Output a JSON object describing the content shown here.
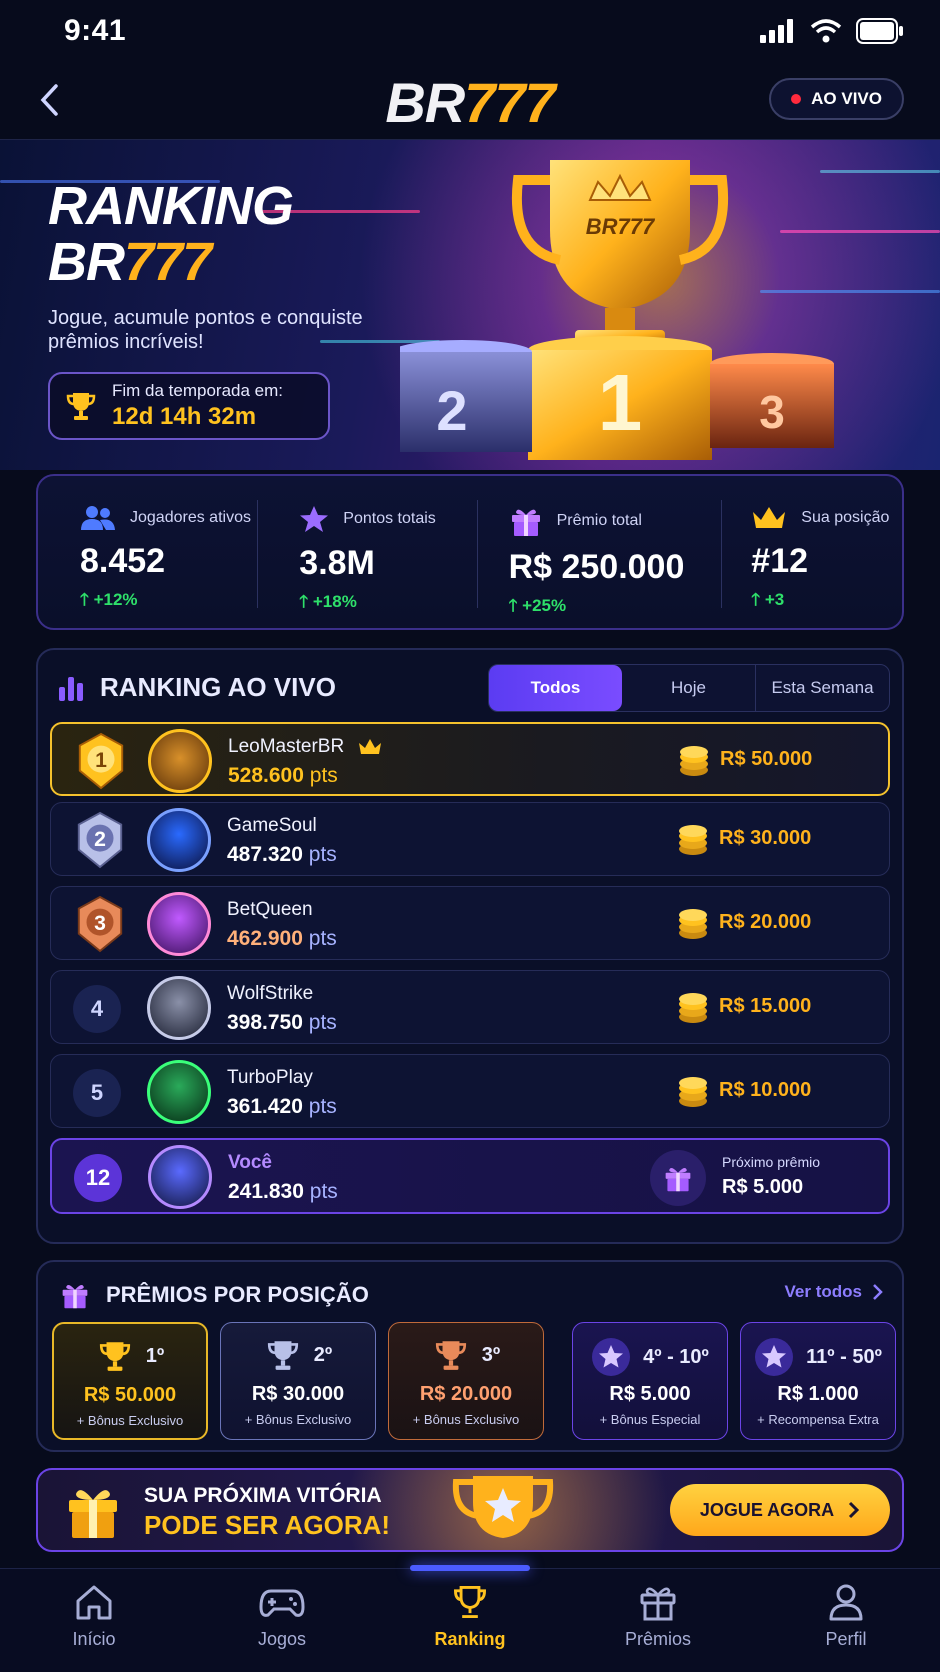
{
  "status": {
    "time": "9:41"
  },
  "header": {
    "logo_a": "BR",
    "logo_b": "777",
    "live_label": "AO VIVO"
  },
  "hero": {
    "title_line1": "RANKING",
    "title_br": "BR",
    "title_777": "777",
    "subtitle": "Jogue, acumule pontos e conquiste prêmios incríveis!",
    "season_label": "Fim da temporada em:",
    "season_value": "12d 14h  32m",
    "trophy_brand": "BR777",
    "podium": [
      "1",
      "2",
      "3"
    ]
  },
  "stats": [
    {
      "label": "Jogadores ativos",
      "value": "8.452",
      "delta": "+12%",
      "icon": "users-icon"
    },
    {
      "label": "Pontos totais",
      "value": "3.8M",
      "delta": "+18%",
      "icon": "star-icon"
    },
    {
      "label": "Prêmio total",
      "value": "R$ 250.000",
      "delta": "+25%",
      "icon": "gift-icon"
    },
    {
      "label": "Sua posição",
      "value": "#12",
      "delta": "+3",
      "icon": "crown-icon"
    }
  ],
  "ranking": {
    "title": "RANKING AO VIVO",
    "tabs": [
      "Todos",
      "Hoje",
      "Esta Semana"
    ],
    "rows": [
      {
        "pos": "1",
        "name": "LeoMasterBR",
        "points": "528.600",
        "unit": "pts",
        "prize": "R$ 50.000"
      },
      {
        "pos": "2",
        "name": "GameSoul",
        "points": "487.320",
        "unit": "pts",
        "prize": "R$ 30.000"
      },
      {
        "pos": "3",
        "name": "BetQueen",
        "points": "462.900",
        "unit": "pts",
        "prize": "R$ 20.000"
      },
      {
        "pos": "4",
        "name": "WolfStrike",
        "points": "398.750",
        "unit": "pts",
        "prize": "R$ 15.000"
      },
      {
        "pos": "5",
        "name": "TurboPlay",
        "points": "361.420",
        "unit": "pts",
        "prize": "R$ 10.000"
      }
    ],
    "me": {
      "pos": "12",
      "name": "Você",
      "points": "241.830",
      "unit": "pts",
      "next_label": "Próximo prêmio",
      "next_value": "R$ 5.000"
    }
  },
  "prizes": {
    "title": "PRÊMIOS POR POSIÇÃO",
    "see_all": "Ver todos",
    "cards": [
      {
        "pos": "1º",
        "amount": "R$ 50.000",
        "bonus": "+ Bônus Exclusivo"
      },
      {
        "pos": "2º",
        "amount": "R$ 30.000",
        "bonus": "+ Bônus Exclusivo"
      },
      {
        "pos": "3º",
        "amount": "R$ 20.000",
        "bonus": "+ Bônus Exclusivo"
      },
      {
        "pos": "4º - 10º",
        "amount": "R$ 5.000",
        "bonus": "+ Bônus Especial"
      },
      {
        "pos": "11º - 50º",
        "amount": "R$ 1.000",
        "bonus": "+ Recompensa Extra"
      }
    ]
  },
  "promo": {
    "line1": "SUA PRÓXIMA VITÓRIA",
    "line2": "PODE SER AGORA!",
    "cta": "JOGUE AGORA"
  },
  "bottom_nav": [
    {
      "label": "Início",
      "icon": "home-icon"
    },
    {
      "label": "Jogos",
      "icon": "gamepad-icon"
    },
    {
      "label": "Ranking",
      "icon": "trophy-icon"
    },
    {
      "label": "Prêmios",
      "icon": "gift-icon"
    },
    {
      "label": "Perfil",
      "icon": "user-icon"
    }
  ],
  "colors": {
    "gold": "#ffb21c",
    "purple": "#6b44e6",
    "green": "#2ee06a",
    "bg": "#070b1c"
  }
}
